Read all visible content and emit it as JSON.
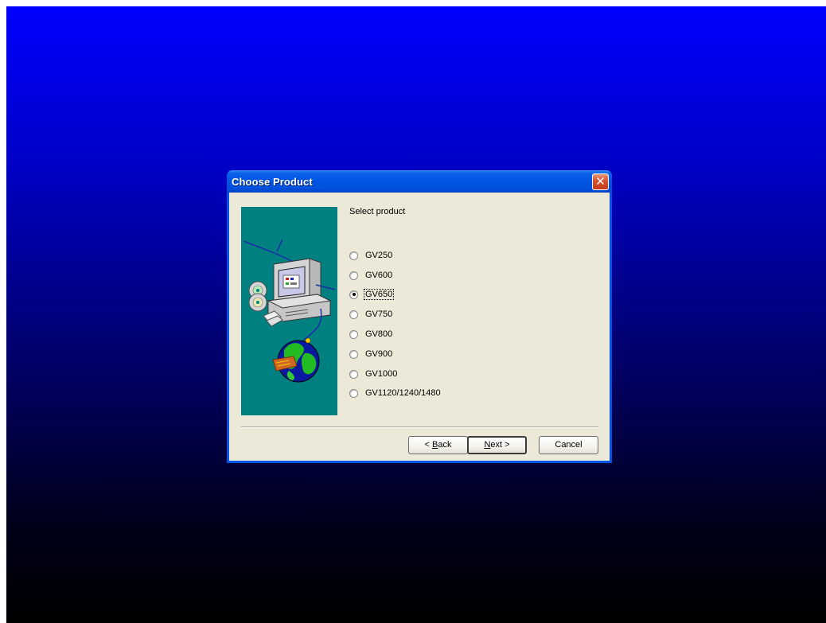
{
  "window": {
    "title": "Choose Product",
    "close_glyph": "✕"
  },
  "prompt": "Select product",
  "products": [
    {
      "label": "GV250",
      "checked": false
    },
    {
      "label": "GV600",
      "checked": false
    },
    {
      "label": "GV650",
      "checked": true
    },
    {
      "label": "GV750",
      "checked": false
    },
    {
      "label": "GV800",
      "checked": false
    },
    {
      "label": "GV900",
      "checked": false
    },
    {
      "label": "GV1000",
      "checked": false
    },
    {
      "label": "GV1120/1240/1480",
      "checked": false
    }
  ],
  "buttons": {
    "back": {
      "prefix": "< ",
      "mnemonic": "B",
      "rest": "ack"
    },
    "next": {
      "mnemonic": "N",
      "rest": "ext",
      "suffix": " >"
    },
    "cancel": "Cancel"
  },
  "side_image_icons": [
    "computer-icon",
    "cd-icon",
    "globe-icon"
  ],
  "colors": {
    "titlebar": "#0054e3",
    "dialog_bg": "#ece9d8",
    "side_panel": "#008080",
    "desktop_top": "#0000ff",
    "desktop_bottom": "#000000"
  }
}
